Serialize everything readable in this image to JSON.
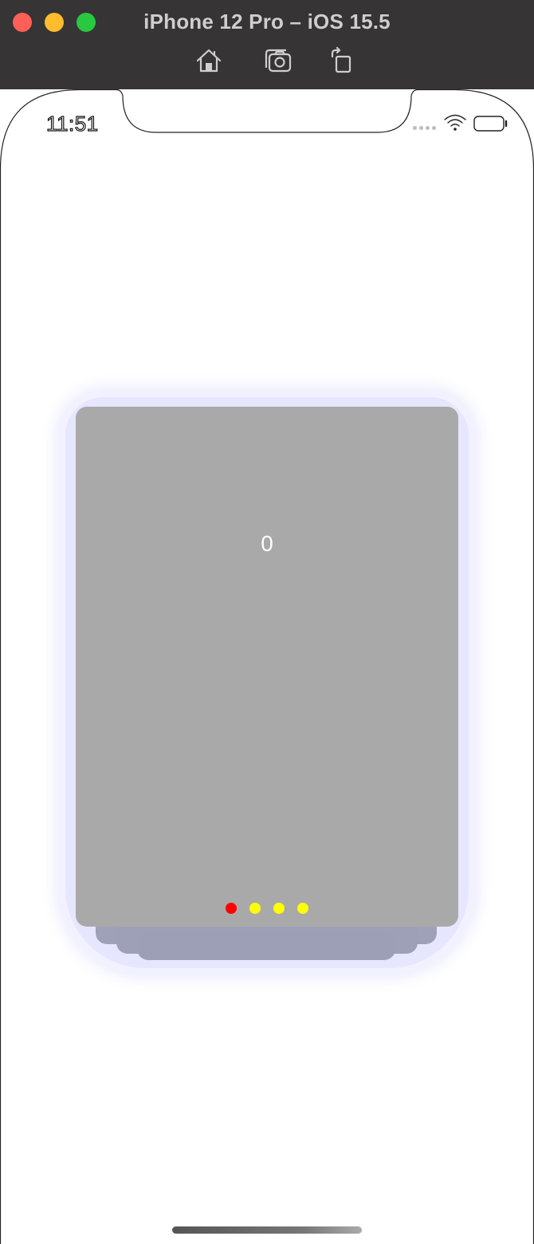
{
  "window": {
    "title": "iPhone 12 Pro – iOS 15.5",
    "toolbar_icons": [
      "home-icon",
      "screenshot-icon",
      "rotate-icon"
    ]
  },
  "status_bar": {
    "time": "11:51",
    "icons": [
      "cellular-signal-icon",
      "wifi-icon",
      "battery-icon"
    ]
  },
  "card": {
    "number": "0",
    "background": "#a9a9a9",
    "page_indicator": {
      "count": 4,
      "current_index": 0,
      "active_color": "#ff0000",
      "inactive_color": "#ffff00"
    }
  },
  "colors": {
    "titlebar": "#373435",
    "traffic_close": "#fe5f57",
    "traffic_minimize": "#febc2e",
    "traffic_zoom": "#28c840",
    "stacked_cards": "#9c9eb8",
    "glow": "#e2e2ff"
  }
}
